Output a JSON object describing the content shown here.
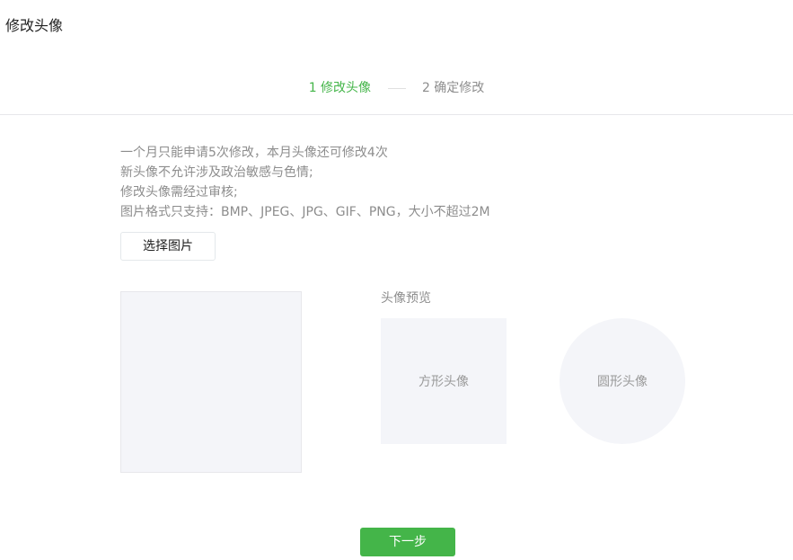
{
  "header": {
    "title": "修改头像"
  },
  "steps": [
    {
      "label": "1 修改头像",
      "active": true
    },
    {
      "label": "2 确定修改",
      "active": false
    }
  ],
  "notes": [
    "一个月只能申请5次修改，本月头像还可修改4次",
    "新头像不允许涉及政治敏感与色情;",
    "修改头像需经过审核;",
    "图片格式只支持：BMP、JPEG、JPG、GIF、PNG，大小不超过2M"
  ],
  "upload": {
    "select_label": "选择图片"
  },
  "preview": {
    "title": "头像预览",
    "square_label": "方形头像",
    "circle_label": "圆形头像"
  },
  "footer": {
    "next_label": "下一步"
  },
  "colors": {
    "accent": "#44b549",
    "muted_text": "#8d8d8d",
    "placeholder_bg": "#f4f5f9"
  }
}
